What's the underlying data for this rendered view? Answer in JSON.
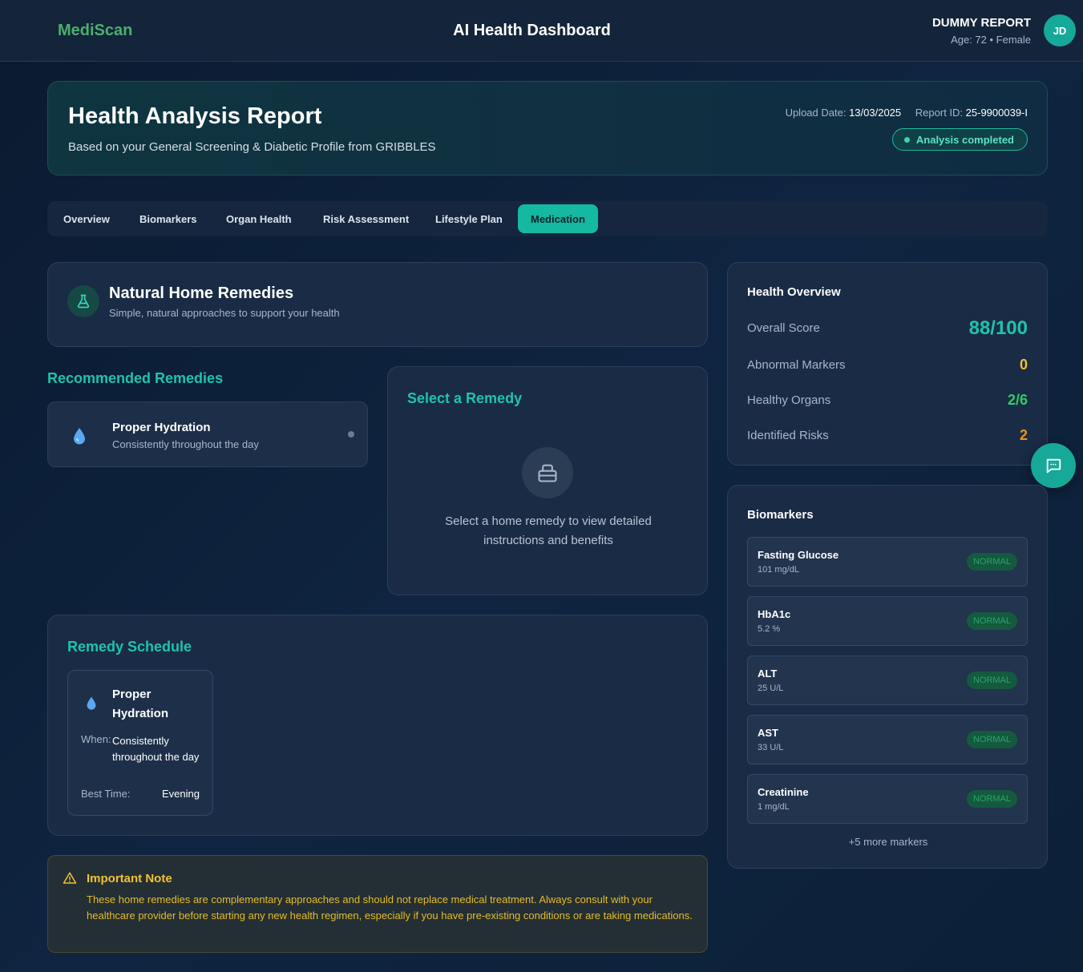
{
  "header": {
    "brand": "MediScan",
    "title": "AI Health Dashboard",
    "user_name": "DUMMY REPORT",
    "user_meta": "Age: 72 • Female",
    "avatar_initials": "JD"
  },
  "report": {
    "title": "Health Analysis Report",
    "subtitle": "Based on your General Screening & Diabetic Profile from GRIBBLES",
    "upload_label": "Upload Date:",
    "upload_date": "13/03/2025",
    "report_id_label": "Report ID:",
    "report_id": "25-9900039-I",
    "status": "Analysis completed"
  },
  "tabs": [
    {
      "label": "Overview"
    },
    {
      "label": "Biomarkers"
    },
    {
      "label": "Organ Health"
    },
    {
      "label": "Risk Assessment"
    },
    {
      "label": "Lifestyle Plan"
    },
    {
      "label": "Medication",
      "active": true
    }
  ],
  "remedies": {
    "title": "Natural Home Remedies",
    "subtitle": "Simple, natural approaches to support your health",
    "icon": "flask-icon",
    "recommended_label": "Recommended Remedies",
    "items": [
      {
        "name": "Proper Hydration",
        "frequency": "Consistently throughout the day",
        "icon": "water-drop-icon"
      }
    ],
    "select": {
      "title": "Select a Remedy",
      "message": "Select a home remedy to view detailed instructions and benefits",
      "icon": "box-icon"
    }
  },
  "schedule": {
    "title": "Remedy Schedule",
    "items": [
      {
        "name": "Proper Hydration",
        "when_label": "When:",
        "when": "Consistently throughout the day",
        "best_time_label": "Best Time:",
        "best_time": "Evening",
        "icon": "water-drop-icon"
      }
    ]
  },
  "note": {
    "title": "Important Note",
    "text": "These home remedies are complementary approaches and should not replace medical treatment. Always consult with your healthcare provider before starting any new health regimen, especially if you have pre-existing conditions or are taking medications.",
    "icon": "warning-icon"
  },
  "overview": {
    "title": "Health Overview",
    "rows": [
      {
        "label": "Overall Score",
        "value": "88/100",
        "color": "#1fc4a8"
      },
      {
        "label": "Abnormal Markers",
        "value": "0",
        "color": "#f2c230"
      },
      {
        "label": "Healthy Organs",
        "value": "2/6",
        "color": "#35c96a"
      },
      {
        "label": "Identified Risks",
        "value": "2",
        "color": "#f0921e"
      }
    ]
  },
  "biomarkers": {
    "title": "Biomarkers",
    "items": [
      {
        "name": "Fasting Glucose",
        "value": "101 mg/dL",
        "status": "NORMAL"
      },
      {
        "name": "HbA1c",
        "value": "5.2 %",
        "status": "NORMAL"
      },
      {
        "name": "ALT",
        "value": "25 U/L",
        "status": "NORMAL"
      },
      {
        "name": "AST",
        "value": "33 U/L",
        "status": "NORMAL"
      },
      {
        "name": "Creatinine",
        "value": "1 mg/dL",
        "status": "NORMAL"
      }
    ],
    "more": "+5 more markers"
  },
  "chat_fab": {
    "icon": "chat-icon"
  }
}
